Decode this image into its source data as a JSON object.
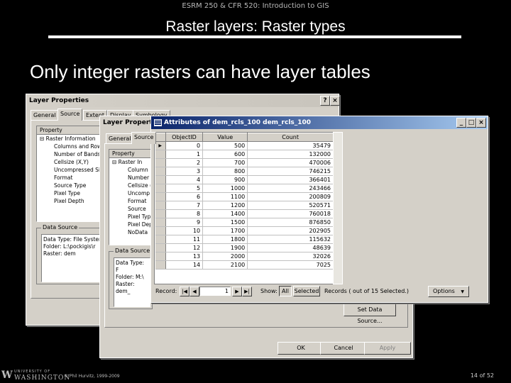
{
  "slide": {
    "course": "ESRM 250 & CFR 520: Introduction to GIS",
    "title": "Raster layers: Raster types",
    "heading": "Only integer rasters can have layer tables",
    "copyright": "© Phil Hurvitz, 1999-2009",
    "page": "14 of 52",
    "logo_line1": "UNIVERSITY OF",
    "logo_line2": "WASHINGTON",
    "logo_mark": "W"
  },
  "layer_props_back": {
    "title": "Layer Properties",
    "help_btn": "?",
    "close_btn": "×",
    "tabs": [
      "General",
      "Source",
      "Extent",
      "Display",
      "Symbology"
    ],
    "grid_header": "Property",
    "properties": [
      "Raster Information",
      "Columns and Rows",
      "Number of Bands",
      "Cellsize (X,Y)",
      "Uncompressed Size",
      "Format",
      "Source Type",
      "Pixel Type",
      "Pixel Depth"
    ],
    "group_label": "Data Source",
    "data_source": [
      "Data Type: File System",
      "Folder: L:\\pockigis\\r",
      "Raster: dem"
    ]
  },
  "layer_props_front": {
    "title": "Layer Properties",
    "tabs": [
      "General",
      "Source"
    ],
    "grid_header": "Property",
    "properties": [
      "Raster In",
      "Column",
      "Number",
      "Cellsize (",
      "Uncomp",
      "Format",
      "Source",
      "Pixel Typ",
      "Pixel Dep",
      "NoData"
    ],
    "group_label": "Data Source",
    "data_source": [
      "Data Type: F",
      "Folder: M:\\",
      "Raster: dem_"
    ],
    "set_source_btn": "Set Data Source...",
    "ok_btn": "OK",
    "cancel_btn": "Cancel",
    "apply_btn": "Apply"
  },
  "attributes": {
    "title": "Attributes of dem_rcls_100   dem_rcls_100",
    "min_btn": "_",
    "max_btn": "□",
    "close_btn": "×",
    "columns": [
      "ObjectID",
      "Value",
      "Count"
    ],
    "rows": [
      [
        "0",
        "500",
        "35479"
      ],
      [
        "1",
        "600",
        "132000"
      ],
      [
        "2",
        "700",
        "470006"
      ],
      [
        "3",
        "800",
        "746215"
      ],
      [
        "4",
        "900",
        "366401"
      ],
      [
        "5",
        "1000",
        "243466"
      ],
      [
        "6",
        "1100",
        "200809"
      ],
      [
        "7",
        "1200",
        "520571"
      ],
      [
        "8",
        "1400",
        "760018"
      ],
      [
        "9",
        "1500",
        "876850"
      ],
      [
        "10",
        "1700",
        "202905"
      ],
      [
        "11",
        "1800",
        "115632"
      ],
      [
        "12",
        "1900",
        "48639"
      ],
      [
        "13",
        "2000",
        "32026"
      ],
      [
        "14",
        "2100",
        "7025"
      ]
    ],
    "record_label": "Record:",
    "record_value": "1",
    "show_label": "Show:",
    "all_btn": "All",
    "selected_btn": "Selected",
    "records_text": "Records (  out of 15 Selected.)",
    "options_btn": "Options",
    "options_arrow": "▼",
    "nav_first": "|◀",
    "nav_prev": "◀",
    "nav_next": "▶",
    "nav_last": "▶|"
  }
}
